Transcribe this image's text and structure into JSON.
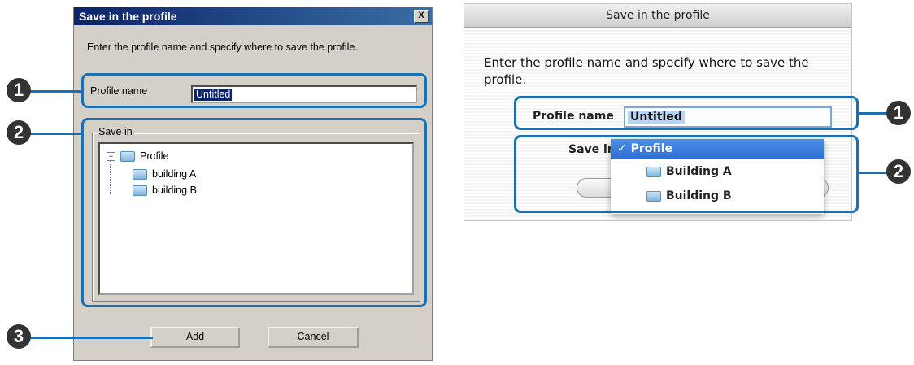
{
  "windows_dialog": {
    "title": "Save in the profile",
    "close_glyph": "X",
    "instruction": "Enter the profile name and specify where to save the profile.",
    "profile_name_label": "Profile name",
    "profile_name_value": "Untitled",
    "save_in_label": "Save in",
    "tree": {
      "root": "Profile",
      "children": [
        "building A",
        "building B"
      ]
    },
    "add_button": "Add",
    "cancel_button": "Cancel"
  },
  "mac_dialog": {
    "title": "Save in the profile",
    "instruction": "Enter the profile name and specify where to save the profile.",
    "profile_name_label": "Profile name",
    "profile_name_value": "Untitled",
    "save_in_label": "Save in",
    "menu": {
      "selected": "✓ Profile",
      "items": [
        "Building A",
        "Building B"
      ]
    }
  },
  "callouts": {
    "one": "1",
    "two": "2",
    "three": "3"
  },
  "colors": {
    "callout_blue": "#1b6fb5",
    "win_titlebar": "#0a246a",
    "mac_selection": "#2f6fd4"
  }
}
